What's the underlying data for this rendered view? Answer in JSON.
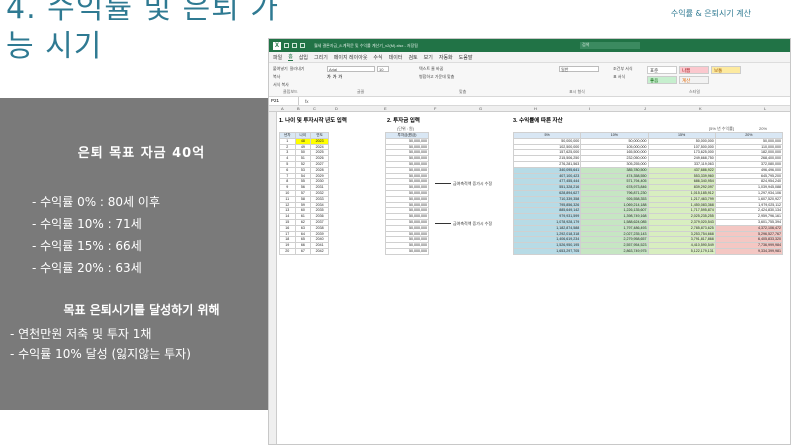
{
  "slide": {
    "title": "4. 수익률 및 은퇴 가능 시기",
    "corner_label": "수익률 & 은퇴시기 계산"
  },
  "panel": {
    "heading": "은퇴 목표 자금  40억",
    "rates": [
      "- 수익률   0% : 80세 이후",
      "- 수익률 10% : 71세",
      "- 수익률 15% : 66세",
      "- 수익률 20% : 63세"
    ],
    "goal_heading": "목표 은퇴시기를 달성하기 위해",
    "goal_items": [
      "- 연천만원 저축 및 투자 1채",
      "- 수익률 10% 달성 (잃지않는 투자)"
    ]
  },
  "excel": {
    "doc_title": "월세 결론자금_8.계획문 및 수익률 계산기_v2(M).xlsx - 저장됨",
    "search_placeholder": "검색",
    "tabs": [
      "파일",
      "홈",
      "삽입",
      "그리기",
      "페이지 레이아웃",
      "수식",
      "데이터",
      "검토",
      "보기",
      "자동화",
      "도움말"
    ],
    "active_tab": "홈",
    "ribbon": {
      "paste": "붙여넣기",
      "cut": "잘라내기",
      "copy": "복사",
      "format_painter": "서식 복사",
      "clipboard": "클립보드",
      "font_name": "Arial",
      "font_size": "10",
      "font_group": "글꼴",
      "wrap": "텍스트 줄 바꿈",
      "merge": "병합하고 가운데 맞춤",
      "align_group": "맞춤",
      "number_format": "일반",
      "number_group": "표시 형식",
      "cond_format": "조건부 서식",
      "table_format": "표 서식",
      "styles": {
        "normal": "표준",
        "bad": "나쁨",
        "good": "좋음",
        "neutral": "보통",
        "calc": "계산"
      },
      "style_group": "스타일"
    },
    "name_box": "P21",
    "fx": "fx",
    "col_headers": [
      "A",
      "B",
      "C",
      "D",
      "E",
      "F",
      "G",
      "H",
      "I",
      "J",
      "K",
      "L"
    ],
    "sections": {
      "s1": "1. 나이 및 투자시작 년도 입력",
      "s2": "2. 투자금 입력",
      "s3": "3. 수익률에 따른 자산",
      "unit": "(단위 : 원)",
      "rate_note": "[5% 년 수익률]",
      "rate_note2": "20%"
    },
    "age_table": {
      "headers": [
        "년차",
        "나이",
        "연도"
      ],
      "rows": [
        [
          "1",
          "48",
          "2023"
        ],
        [
          "2",
          "49",
          "2024"
        ],
        [
          "3",
          "50",
          "2025"
        ],
        [
          "4",
          "51",
          "2026"
        ],
        [
          "5",
          "52",
          "2027"
        ],
        [
          "6",
          "53",
          "2028"
        ],
        [
          "7",
          "54",
          "2029"
        ],
        [
          "8",
          "55",
          "2030"
        ],
        [
          "9",
          "56",
          "2031"
        ],
        [
          "10",
          "57",
          "2032"
        ],
        [
          "11",
          "58",
          "2033"
        ],
        [
          "12",
          "59",
          "2034"
        ],
        [
          "13",
          "60",
          "2035"
        ],
        [
          "14",
          "61",
          "2036"
        ],
        [
          "15",
          "62",
          "2037"
        ],
        [
          "16",
          "63",
          "2038"
        ],
        [
          "17",
          "64",
          "2039"
        ],
        [
          "18",
          "65",
          "2040"
        ],
        [
          "19",
          "66",
          "2041"
        ],
        [
          "20",
          "67",
          "2042"
        ]
      ]
    },
    "invest_header": "투자금(원금)",
    "invest_value": "50,000,000",
    "notes": [
      "금여축적액 증가시 수정",
      "금여축적액 증가시 수정"
    ],
    "asset_headers": [
      "5%",
      "10%",
      "15%",
      "20%"
    ],
    "asset_rows": [
      [
        "50,000,000",
        "50,000,000",
        "50,000,000",
        "50,000,000"
      ],
      [
        "102,500,000",
        "105,000,000",
        "107,500,000",
        "110,000,000"
      ],
      [
        "157,625,000",
        "165,500,000",
        "173,625,000",
        "182,000,000"
      ],
      [
        "215,506,250",
        "232,050,000",
        "249,668,750",
        "268,400,000"
      ],
      [
        "276,281,563",
        "305,255,000",
        "337,119,063",
        "372,080,000"
      ],
      [
        "340,095,641",
        "385,780,500",
        "437,686,922",
        "496,496,000"
      ],
      [
        "407,100,423",
        "474,358,550",
        "553,339,960",
        "645,795,200"
      ],
      [
        "477,455,444",
        "571,794,405",
        "686,340,954",
        "824,954,240"
      ],
      [
        "551,328,216",
        "678,973,846",
        "839,292,097",
        "1,039,945,088"
      ],
      [
        "628,894,627",
        "796,871,230",
        "1,015,185,912",
        "1,297,934,106"
      ],
      [
        "710,339,358",
        "926,558,353",
        "1,217,463,799",
        "1,607,520,927"
      ],
      [
        "795,856,326",
        "1,069,214,188",
        "1,450,083,368",
        "1,979,025,112"
      ],
      [
        "885,649,142",
        "1,226,135,607",
        "1,717,595,874",
        "2,424,830,134"
      ],
      [
        "979,931,599",
        "1,398,749,168",
        "2,025,235,255",
        "2,959,796,161"
      ],
      [
        "1,078,928,179",
        "1,588,624,085",
        "2,379,020,543",
        "3,601,755,394"
      ],
      [
        "1,182,874,588",
        "1,797,486,493",
        "2,785,873,625",
        "4,372,106,472"
      ],
      [
        "1,292,018,318",
        "2,027,235,143",
        "3,253,754,668",
        "5,296,527,767"
      ],
      [
        "1,406,619,234",
        "2,279,958,657",
        "3,791,817,868",
        "6,405,833,320"
      ],
      [
        "1,526,950,195",
        "2,557,954,523",
        "4,410,590,549",
        "7,736,999,984"
      ],
      [
        "1,653,297,705",
        "2,863,749,975",
        "5,122,179,131",
        "9,334,399,981"
      ]
    ]
  }
}
